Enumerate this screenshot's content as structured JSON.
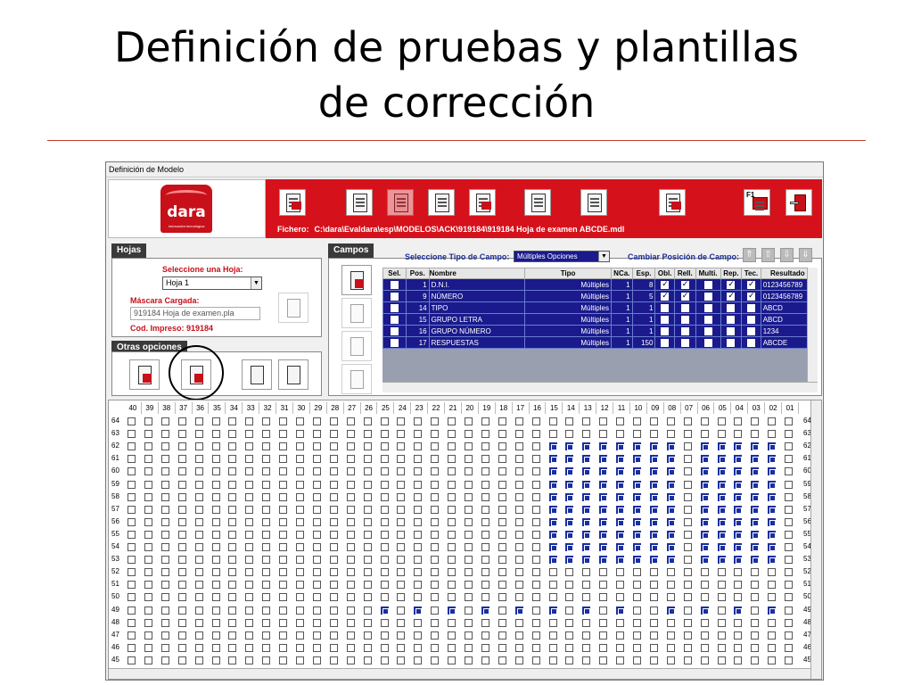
{
  "slide": {
    "title_line1": "Definición de pruebas y plantillas",
    "title_line2": "de corrección"
  },
  "window": {
    "title": "Definición de Modelo"
  },
  "header": {
    "logo_text": "dara",
    "logo_tagline": "Innovación tecnológica",
    "fichero_label": "Fichero:",
    "fichero_path": "C:\\dara\\Evaldara\\esp\\MODELOS\\ACK\\919184\\919184 Hoja de examen ABCDE.mdl",
    "help_key": "F1"
  },
  "hojas": {
    "tab": "Hojas",
    "select_label": "Seleccione una Hoja:",
    "select_value": "Hoja 1",
    "mask_label": "Máscara Cargada:",
    "mask_value": "919184 Hoja de examen.pla",
    "cod_label": "Cod. Impreso: 919184"
  },
  "otras": {
    "tab": "Otras opciones"
  },
  "campos": {
    "tab": "Campos",
    "tipo_label": "Seleccione Tipo de Campo:",
    "tipo_value": "Múltiples Opciones",
    "cambiar_label": "Cambiar Posición de Campo:",
    "columns": [
      "Sel.",
      "Pos.",
      "Nombre",
      "Tipo",
      "NCa.",
      "Esp.",
      "Obl.",
      "Rell.",
      "Multi.",
      "Rep.",
      "Tec.",
      "Resultado"
    ],
    "rows": [
      {
        "pos": "1",
        "nombre": "D.N.I.",
        "tipo": "Múltiples",
        "nca": "1",
        "esp": "8",
        "obl": true,
        "rell": true,
        "multi": false,
        "rep": true,
        "tec": true,
        "resultado": "0123456789"
      },
      {
        "pos": "9",
        "nombre": "NÚMERO",
        "tipo": "Múltiples",
        "nca": "1",
        "esp": "5",
        "obl": true,
        "rell": true,
        "multi": false,
        "rep": true,
        "tec": true,
        "resultado": "0123456789"
      },
      {
        "pos": "14",
        "nombre": "TIPO",
        "tipo": "Múltiples",
        "nca": "1",
        "esp": "1",
        "obl": false,
        "rell": false,
        "multi": false,
        "rep": false,
        "tec": false,
        "resultado": "ABCD"
      },
      {
        "pos": "15",
        "nombre": "GRUPO LETRA",
        "tipo": "Múltiples",
        "nca": "1",
        "esp": "1",
        "obl": false,
        "rell": false,
        "multi": false,
        "rep": false,
        "tec": false,
        "resultado": "ABCD"
      },
      {
        "pos": "16",
        "nombre": "GRUPO NÚMERO",
        "tipo": "Múltiples",
        "nca": "1",
        "esp": "1",
        "obl": false,
        "rell": false,
        "multi": false,
        "rep": false,
        "tec": false,
        "resultado": "1234"
      },
      {
        "pos": "17",
        "nombre": "RESPUESTAS",
        "tipo": "Múltiples",
        "nca": "1",
        "esp": "150",
        "obl": false,
        "rell": false,
        "multi": false,
        "rep": false,
        "tec": false,
        "resultado": "ABCDE"
      }
    ]
  },
  "grid": {
    "columns": [
      "40",
      "39",
      "38",
      "37",
      "36",
      "35",
      "34",
      "33",
      "32",
      "31",
      "30",
      "29",
      "28",
      "27",
      "26",
      "25",
      "24",
      "23",
      "22",
      "21",
      "20",
      "19",
      "18",
      "17",
      "16",
      "15",
      "14",
      "13",
      "12",
      "11",
      "10",
      "09",
      "08",
      "07",
      "06",
      "05",
      "04",
      "03",
      "02",
      "01"
    ],
    "rows": [
      "64",
      "63",
      "62",
      "61",
      "60",
      "59",
      "58",
      "57",
      "56",
      "55",
      "54",
      "53",
      "52",
      "51",
      "50",
      "49",
      "48",
      "47",
      "46",
      "45"
    ],
    "filled_block_rows": [
      "62",
      "61",
      "60",
      "59",
      "58",
      "57",
      "56",
      "55",
      "54",
      "53"
    ],
    "filled_block_cols": [
      "15",
      "14",
      "13",
      "12",
      "11",
      "10",
      "09",
      "08",
      "06",
      "05",
      "04",
      "03",
      "02"
    ],
    "row49_filled_cols": [
      "25",
      "23",
      "21",
      "19",
      "17",
      "15",
      "13",
      "11",
      "08",
      "06",
      "04",
      "02"
    ]
  }
}
